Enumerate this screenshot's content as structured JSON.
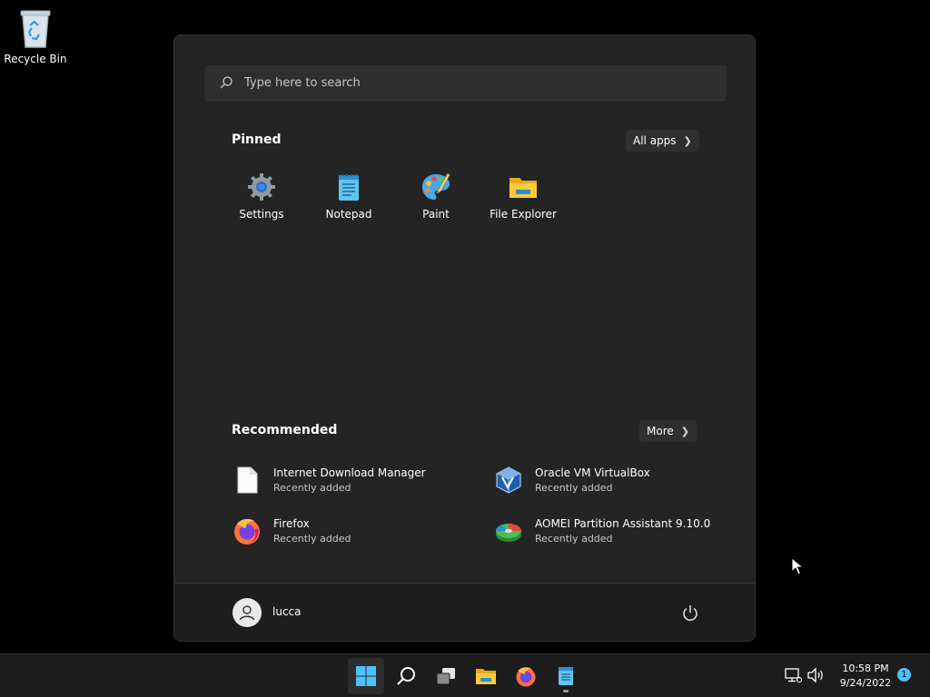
{
  "desktop": {
    "recycle_bin_label": "Recycle Bin"
  },
  "start_menu": {
    "search": {
      "placeholder": "Type here to search"
    },
    "pinned": {
      "title": "Pinned",
      "all_apps_label": "All apps",
      "apps": [
        {
          "label": "Settings",
          "icon": "settings-icon"
        },
        {
          "label": "Notepad",
          "icon": "notepad-icon"
        },
        {
          "label": "Paint",
          "icon": "paint-icon"
        },
        {
          "label": "File Explorer",
          "icon": "file-explorer-icon"
        }
      ]
    },
    "recommended": {
      "title": "Recommended",
      "more_label": "More",
      "items": [
        {
          "name": "Internet Download Manager",
          "sub": "Recently added",
          "icon": "document-icon"
        },
        {
          "name": "Oracle VM VirtualBox",
          "sub": "Recently added",
          "icon": "virtualbox-icon"
        },
        {
          "name": "Firefox",
          "sub": "Recently added",
          "icon": "firefox-icon"
        },
        {
          "name": "AOMEI Partition Assistant 9.10.0",
          "sub": "Recently added",
          "icon": "aomei-icon"
        }
      ]
    },
    "user": {
      "name": "lucca"
    }
  },
  "taskbar": {
    "apps": [
      "start-icon",
      "search-icon",
      "task-view-icon",
      "file-explorer-icon",
      "firefox-icon",
      "notepad-icon"
    ],
    "clock": {
      "time": "10:58 PM",
      "date": "9/24/2022"
    },
    "notification_count": "1"
  },
  "colors": {
    "accent": "#4cc2ff",
    "menu_bg": "#242424",
    "taskbar_bg": "#1c1c1c"
  }
}
